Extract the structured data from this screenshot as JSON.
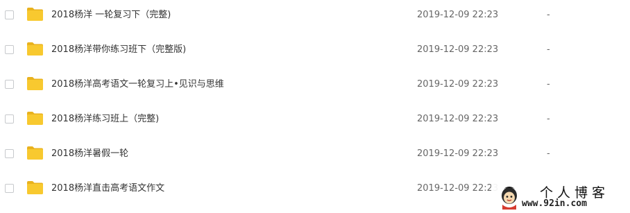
{
  "files": [
    {
      "name": "2018杨洋 一轮复习下（完整)",
      "modified": "2019-12-09 22:23",
      "size": "-",
      "icon": "folder-icon"
    },
    {
      "name": "2018杨洋带你练习班下（完整版)",
      "modified": "2019-12-09 22:23",
      "size": "-",
      "icon": "folder-icon"
    },
    {
      "name": "2018杨洋高考语文一轮复习上•见识与思维",
      "modified": "2019-12-09 22:23",
      "size": "-",
      "icon": "folder-icon"
    },
    {
      "name": "2018杨洋练习班上（完整)",
      "modified": "2019-12-09 22:23",
      "size": "-",
      "icon": "folder-icon"
    },
    {
      "name": "2018杨洋暑假一轮",
      "modified": "2019-12-09 22:23",
      "size": "-",
      "icon": "folder-icon"
    },
    {
      "name": "2018杨洋直击高考语文作文",
      "modified": "2019-12-09 22:23",
      "size": "",
      "icon": "folder-icon"
    }
  ],
  "watermark": {
    "title": "个人博客",
    "url": "www.92in.com"
  },
  "colors": {
    "folder": "#f8c92f",
    "folder_tab": "#e9b21e",
    "text": "#333333",
    "meta_text": "#666666",
    "checkbox_border": "#c7c9cc"
  }
}
